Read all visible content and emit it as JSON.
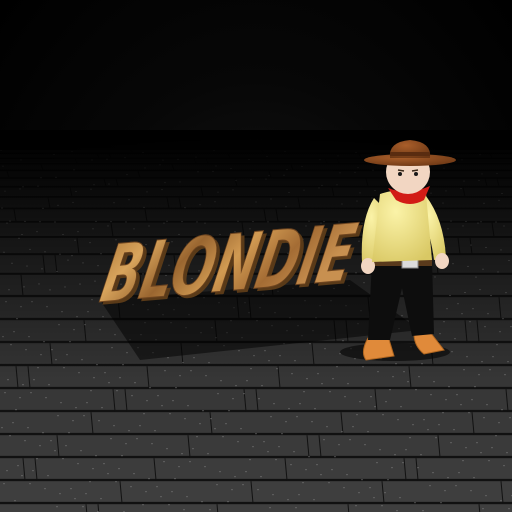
{
  "scene": {
    "title_text": "BLONDIE",
    "character": "cartoon-cowboy",
    "floor": "wooden-boardwalk",
    "colors": {
      "background": "#000000",
      "floor_plank": "#3a3a3a",
      "floor_gap": "#111111",
      "text_wood_light": "#c9944e",
      "text_wood_dark": "#8a5a26",
      "hat": "#8b4a1e",
      "bandana": "#d21c16",
      "shirt": "#f0e48a",
      "pants": "#0d0d0d",
      "boots": "#e08a3a",
      "skin": "#f2d6c2",
      "hair": "#3b2a1a"
    }
  }
}
